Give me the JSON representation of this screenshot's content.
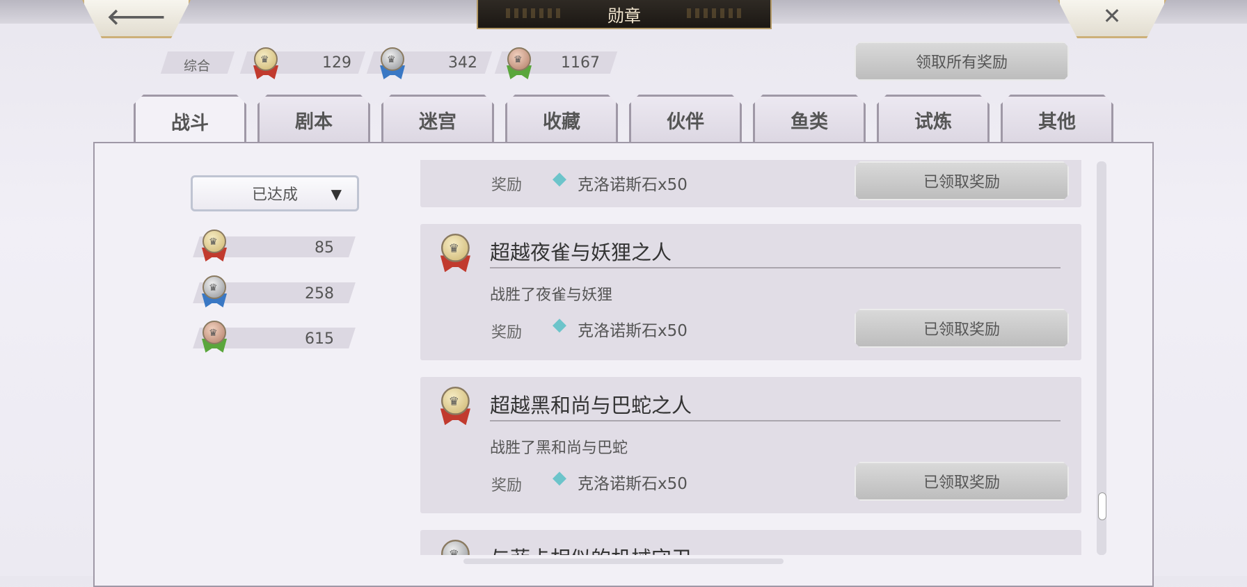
{
  "window": {
    "title": "勋章"
  },
  "nav": {
    "back_icon": "arrow-left-icon",
    "close_icon": "close-x-icon",
    "back_glyph": "🡐",
    "close_glyph": "✕"
  },
  "summary": {
    "label": "综合",
    "gold": "129",
    "silver": "342",
    "bronze": "1167"
  },
  "claim_all_label": "领取所有奖励",
  "tabs": [
    "战斗",
    "剧本",
    "迷宫",
    "收藏",
    "伙伴",
    "鱼类",
    "试炼",
    "其他"
  ],
  "active_tab": "战斗",
  "filter": {
    "selected": "已达成",
    "arrow": "▼"
  },
  "side_counts": {
    "gold": "85",
    "silver": "258",
    "bronze": "615"
  },
  "achievements": [
    {
      "title": "",
      "description": "",
      "reward_label": "奖励",
      "reward": "克洛诺斯石x50",
      "button": "已领取奖励"
    },
    {
      "title": "超越夜雀与妖狸之人",
      "description": "战胜了夜雀与妖狸",
      "reward_label": "奖励",
      "reward": "克洛诺斯石x50",
      "button": "已领取奖励",
      "medal": "gold"
    },
    {
      "title": "超越黑和尚与巴蛇之人",
      "description": "战胜了黑和尚与巴蛇",
      "reward_label": "奖励",
      "reward": "克洛诺斯石x50",
      "button": "已领取奖励",
      "medal": "gold"
    },
    {
      "title": "与菲卡相似的机械守卫",
      "medal": "silver"
    }
  ],
  "colors": {
    "gold_ribbon": "#c13a2e",
    "silver_ribbon": "#3a78c4",
    "bronze_ribbon": "#5aa63c",
    "title_bar": "#1b1713"
  }
}
